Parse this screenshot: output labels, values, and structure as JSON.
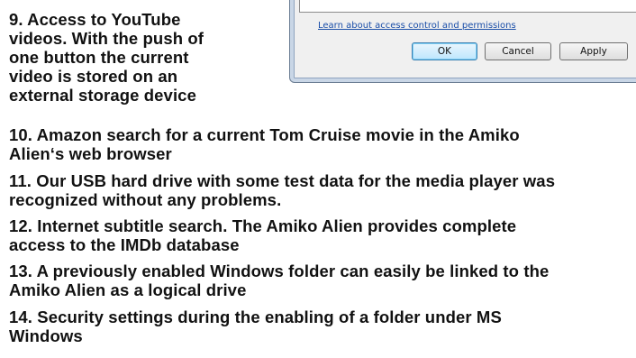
{
  "captions": [
    {
      "lines": [
        "9. Access to YouTube",
        "videos. With the push of",
        "one button the current",
        "video is stored on an",
        "external storage device"
      ]
    },
    {
      "lines": [
        "10. Amazon search for a current Tom Cruise movie in the Amiko",
        "Alien‘s web browser"
      ]
    },
    {
      "lines": [
        "11. Our USB hard drive with some test data for the media player was",
        "recognized without any problems."
      ]
    },
    {
      "lines": [
        "12. Internet subtitle search. The Amiko Alien provides complete",
        "access to the IMDb database"
      ]
    },
    {
      "lines": [
        "13. A previously enabled Windows folder can easily be linked to the",
        "Amiko Alien as a logical drive"
      ]
    },
    {
      "lines": [
        "14. Security settings during the enabling of a folder under MS",
        "Windows"
      ]
    }
  ],
  "dialog": {
    "link_text": "Learn about access control and permissions",
    "ok_label": "OK",
    "cancel_label": "Cancel",
    "apply_label": "Apply"
  }
}
